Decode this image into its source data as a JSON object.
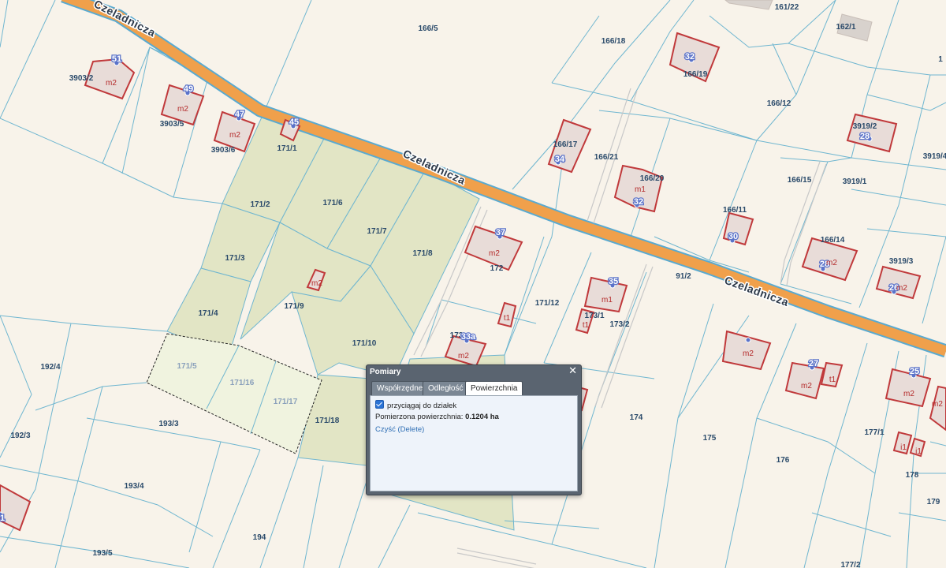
{
  "map": {
    "street_name": "Czeladnicza",
    "parcels": [
      {
        "id": "p-166-5",
        "label": "166/5",
        "faint": false
      },
      {
        "id": "p-166-18",
        "label": "166/18",
        "faint": false
      },
      {
        "id": "p-161-22",
        "label": "161/22",
        "faint": false
      },
      {
        "id": "p-162-1",
        "label": "162/1",
        "faint": false
      },
      {
        "id": "p-3903-2",
        "label": "3903/2",
        "faint": false
      },
      {
        "id": "p-3903-5",
        "label": "3903/5",
        "faint": false
      },
      {
        "id": "p-3903-6",
        "label": "3903/6",
        "faint": false
      },
      {
        "id": "p-166-19",
        "label": "166/19",
        "faint": false
      },
      {
        "id": "p-166-12",
        "label": "166/12",
        "faint": false
      },
      {
        "id": "p-3919-2",
        "label": "3919/2",
        "faint": false
      },
      {
        "id": "p-166-17",
        "label": "166/17",
        "faint": false
      },
      {
        "id": "p-166-21",
        "label": "166/21",
        "faint": false
      },
      {
        "id": "p-166-20",
        "label": "166/20",
        "faint": false
      },
      {
        "id": "p-3919-4",
        "label": "3919/4",
        "faint": false
      },
      {
        "id": "p-166-15",
        "label": "166/15",
        "faint": false
      },
      {
        "id": "p-3919-1",
        "label": "3919/1",
        "faint": false
      },
      {
        "id": "p-171-1",
        "label": "171/1",
        "faint": false
      },
      {
        "id": "p-171-2",
        "label": "171/2",
        "faint": false
      },
      {
        "id": "p-171-6",
        "label": "171/6",
        "faint": false
      },
      {
        "id": "p-171-7",
        "label": "171/7",
        "faint": false
      },
      {
        "id": "p-171-8",
        "label": "171/8",
        "faint": false
      },
      {
        "id": "p-171-3",
        "label": "171/3",
        "faint": false
      },
      {
        "id": "p-171-9",
        "label": "171/9",
        "faint": false
      },
      {
        "id": "p-171-4",
        "label": "171/4",
        "faint": false
      },
      {
        "id": "p-171-10",
        "label": "171/10",
        "faint": false
      },
      {
        "id": "p-171-5",
        "label": "171/5",
        "faint": true
      },
      {
        "id": "p-171-16",
        "label": "171/16",
        "faint": true
      },
      {
        "id": "p-171-17",
        "label": "171/17",
        "faint": true
      },
      {
        "id": "p-171-18",
        "label": "171/18",
        "faint": false
      },
      {
        "id": "p-192-4",
        "label": "192/4",
        "faint": false
      },
      {
        "id": "p-192-3",
        "label": "192/3",
        "faint": false
      },
      {
        "id": "p-193-3",
        "label": "193/3",
        "faint": false
      },
      {
        "id": "p-193-4",
        "label": "193/4",
        "faint": false
      },
      {
        "id": "p-193-5",
        "label": "193/5",
        "faint": false
      },
      {
        "id": "p-194",
        "label": "194",
        "faint": false
      },
      {
        "id": "p-172",
        "label": "172",
        "faint": false
      },
      {
        "id": "p-171-12",
        "label": "171/12",
        "faint": false
      },
      {
        "id": "p-173-1",
        "label": "173/1",
        "faint": false
      },
      {
        "id": "p-173-2",
        "label": "173/2",
        "faint": false
      },
      {
        "id": "p-91-2",
        "label": "91/2",
        "faint": false
      },
      {
        "id": "p-166-11",
        "label": "166/11",
        "faint": false
      },
      {
        "id": "p-166-14",
        "label": "166/14",
        "faint": false
      },
      {
        "id": "p-3919-3",
        "label": "3919/3",
        "faint": false
      },
      {
        "id": "p-174",
        "label": "174",
        "faint": false
      },
      {
        "id": "p-175",
        "label": "175",
        "faint": false
      },
      {
        "id": "p-176",
        "label": "176",
        "faint": false
      },
      {
        "id": "p-177-1",
        "label": "177/1",
        "faint": false
      },
      {
        "id": "p-177-2",
        "label": "177/2",
        "faint": false
      },
      {
        "id": "p-178",
        "label": "178",
        "faint": false
      },
      {
        "id": "p-179",
        "label": "179",
        "faint": false
      },
      {
        "id": "p-173",
        "label": "173",
        "faint": false
      },
      {
        "id": "p-1",
        "label": "1",
        "faint": false
      }
    ],
    "house_numbers": [
      "51",
      "49",
      "47",
      "45",
      "32",
      "34",
      "32",
      "28",
      "30",
      "37",
      "33a",
      "35",
      "28",
      "26",
      "25",
      "27",
      "1"
    ],
    "building_labels": [
      "m2",
      "m2",
      "m2",
      "m2",
      "m1",
      "m2",
      "m2",
      "m1",
      "t1",
      "t1",
      "m2",
      "m2",
      "m2",
      "t1",
      "m2",
      "m2",
      "i1",
      "i1",
      "m2"
    ]
  },
  "dialog": {
    "title": "Pomiary",
    "close_glyph": "✕",
    "tabs": [
      {
        "label": "Współrzędne",
        "active": false
      },
      {
        "label": "Odległość",
        "active": false
      },
      {
        "label": "Powierzchnia",
        "active": true
      }
    ],
    "snap_label": "przyciągaj do działek",
    "snap_checked": true,
    "area_label": "Pomierzona powierzchnia:",
    "area_value": "0.1204 ha",
    "clear_link": "Czyść (Delete)"
  },
  "colors": {
    "background": "#f8f3ea",
    "parcel_line": "#6fb6d0",
    "road": "#f0a04b",
    "building_fill": "#e8dcd8",
    "building_stroke": "#c0393b",
    "highlight_fill": "#e2e5c5",
    "point_marker": "#5b73c9"
  }
}
